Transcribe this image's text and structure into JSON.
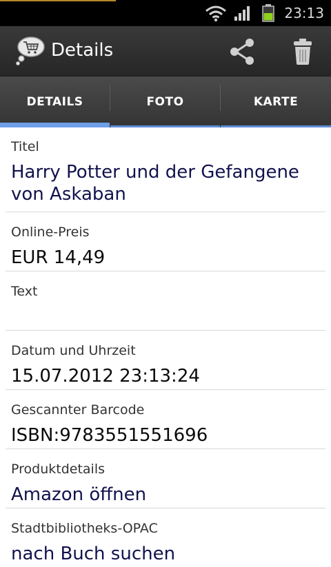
{
  "status_bar": {
    "time": "23:13",
    "icons": [
      "wifi-icon",
      "signal-icon",
      "battery-icon"
    ]
  },
  "action_bar": {
    "title": "Details",
    "app_icon": "shopping-cart-thought-bubble-icon",
    "actions": [
      "share-icon",
      "trash-icon"
    ]
  },
  "tabs": [
    {
      "label": "DETAILS",
      "active": true
    },
    {
      "label": "FOTO",
      "active": false
    },
    {
      "label": "KARTE",
      "active": false
    }
  ],
  "fields": {
    "title": {
      "label": "Titel",
      "value": "Harry Potter und der Gefangene\nvon Askaban"
    },
    "price": {
      "label": "Online-Preis",
      "value": "EUR 14,49"
    },
    "text": {
      "label": "Text",
      "value": ""
    },
    "datetime": {
      "label": "Datum und Uhrzeit",
      "value": "15.07.2012 23:13:24"
    },
    "barcode": {
      "label": "Gescannter Barcode",
      "value": "ISBN:9783551551696"
    },
    "product": {
      "label": "Produktdetails",
      "value": "Amazon öffnen"
    },
    "opac": {
      "label": "Stadtbibliotheks-OPAC",
      "value": "nach Buch suchen"
    }
  },
  "colors": {
    "accent_tab_indicator": "#6f9fe8",
    "value_text_dark_blue": "#12124e",
    "battery_green": "#8ed21c"
  }
}
